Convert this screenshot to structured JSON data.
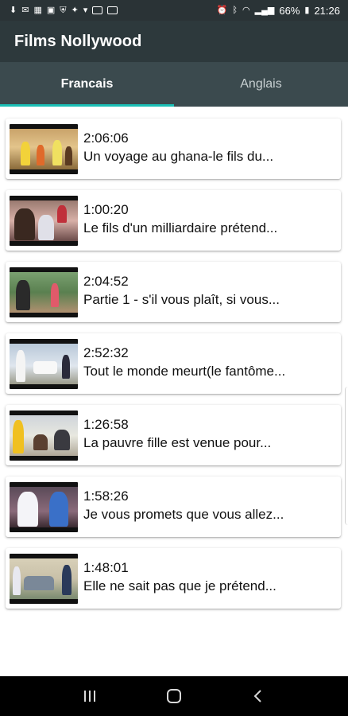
{
  "status_bar": {
    "battery": "66%",
    "time": "21:26"
  },
  "app_bar": {
    "title": "Films Nollywood"
  },
  "tabs": [
    {
      "label": "Francais",
      "active": true
    },
    {
      "label": "Anglais",
      "active": false
    }
  ],
  "colors": {
    "accent": "#1bbfb5",
    "app_bar": "#2d393c",
    "tab_bar": "#3b4a4e"
  },
  "videos": [
    {
      "duration": "2:06:06",
      "title": "Un voyage au ghana-le fils du..."
    },
    {
      "duration": "1:00:20",
      "title": "Le fils d'un milliardaire prétend..."
    },
    {
      "duration": "2:04:52",
      "title": "Partie 1 - s'il vous plaît, si vous..."
    },
    {
      "duration": "2:52:32",
      "title": "Tout le monde meurt(le fantôme..."
    },
    {
      "duration": "1:26:58",
      "title": "La pauvre fille est venue pour..."
    },
    {
      "duration": "1:58:26",
      "title": "Je vous promets que vous allez..."
    },
    {
      "duration": "1:48:01",
      "title": "Elle ne sait pas que je prétend..."
    }
  ],
  "nav": {
    "recents_icon": "recents-icon",
    "home_icon": "home-icon",
    "back_icon": "back-icon"
  }
}
